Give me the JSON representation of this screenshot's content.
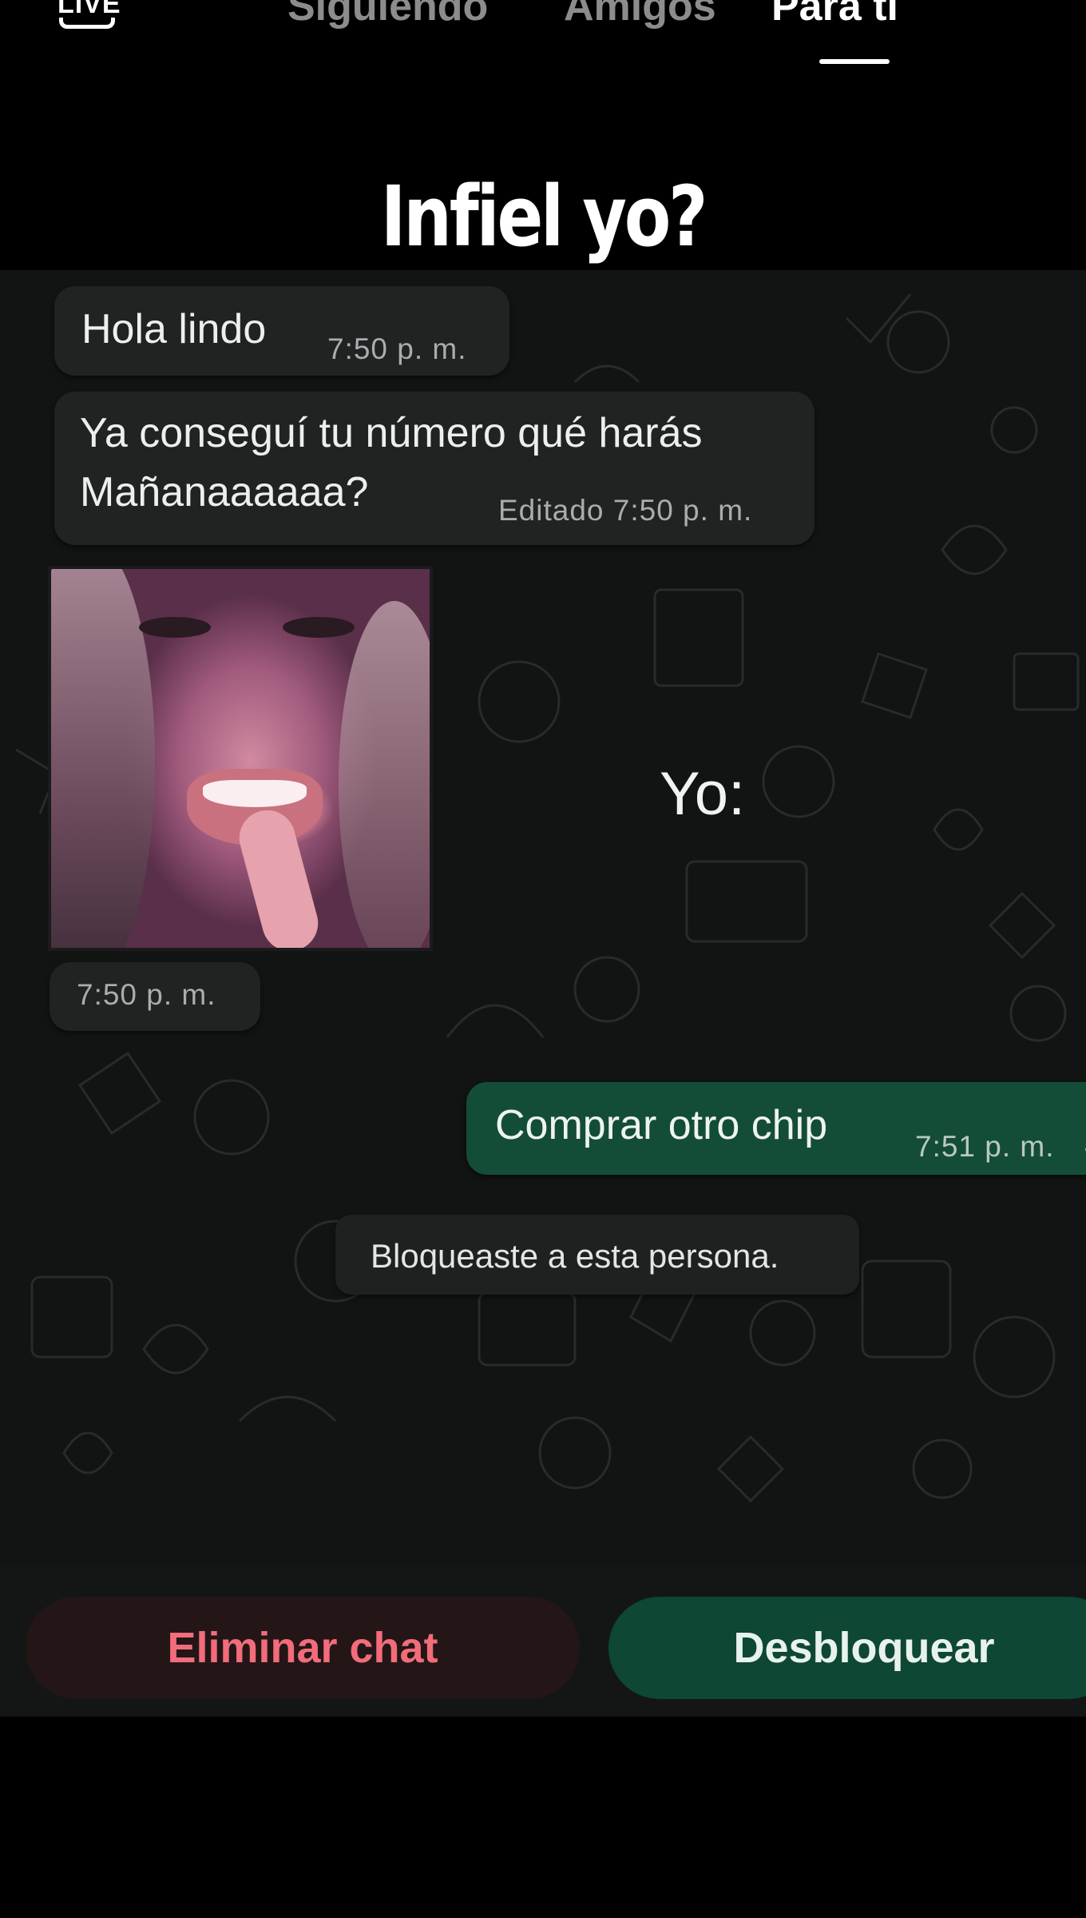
{
  "topnav": {
    "live_label": "LIVE",
    "tabs": [
      {
        "label": "Siguiendo",
        "active": false
      },
      {
        "label": "Amigos",
        "active": false
      },
      {
        "label": "Para ti",
        "active": true
      }
    ]
  },
  "caption": "Infiel yo?",
  "chat": {
    "messages": [
      {
        "text": "Hola lindo",
        "time": "7:50 p. m."
      },
      {
        "lines": [
          "Ya conseguí tu número qué harás",
          "Mañanaaaaaa?"
        ],
        "time": "Editado 7:50 p. m."
      },
      {
        "type": "image",
        "time": "7:50 p. m."
      }
    ],
    "overlay_text": "Yo:",
    "outgoing": {
      "text": "Comprar otro chip",
      "time": "7:51 p. m."
    },
    "system_message": "Bloqueaste a esta persona."
  },
  "actions": {
    "delete_label": "Eliminar chat",
    "unblock_label": "Desbloquear"
  },
  "colors": {
    "background": "#000000",
    "chat_bg": "#121313",
    "incoming_bubble": "#202322",
    "outgoing_bubble": "#144d37",
    "delete_text": "#f26c7b",
    "unblock_bg": "#0e4733"
  }
}
